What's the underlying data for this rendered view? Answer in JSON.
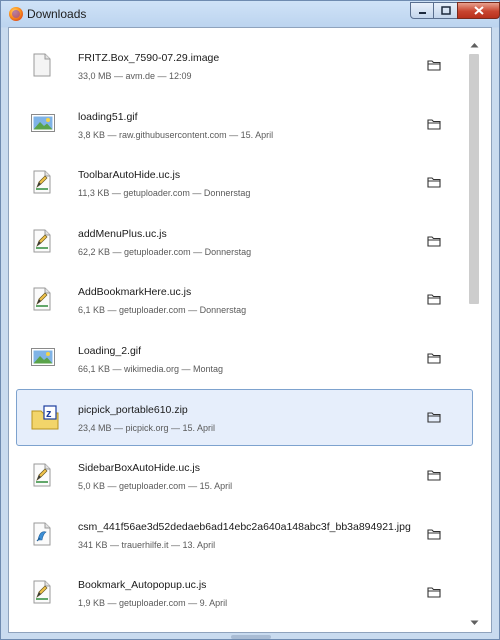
{
  "window": {
    "title": "Downloads"
  },
  "colors": {
    "selection_bg": "#e6eefb",
    "selection_border": "#7da2ce",
    "close_button": "#c8452f"
  },
  "downloads": [
    {
      "name": "FRITZ.Box_7590-07.29.image",
      "meta": "33,0 MB — avm.de — 12:09",
      "icon": "blank-file-icon"
    },
    {
      "name": "loading51.gif",
      "meta": "3,8 KB — raw.githubusercontent.com — 15. April",
      "icon": "image-file-icon"
    },
    {
      "name": "ToolbarAutoHide.uc.js",
      "meta": "11,3 KB — getuploader.com — Donnerstag",
      "icon": "script-file-icon"
    },
    {
      "name": "addMenuPlus.uc.js",
      "meta": "62,2 KB — getuploader.com — Donnerstag",
      "icon": "script-file-icon"
    },
    {
      "name": "AddBookmarkHere.uc.js",
      "meta": "6,1 KB — getuploader.com — Donnerstag",
      "icon": "script-file-icon"
    },
    {
      "name": "Loading_2.gif",
      "meta": "66,1 KB — wikimedia.org — Montag",
      "icon": "image-file-icon"
    },
    {
      "name": "picpick_portable610.zip",
      "meta": "23,4 MB — picpick.org — 15. April",
      "icon": "zip-archive-icon",
      "selected": true
    },
    {
      "name": "SidebarBoxAutoHide.uc.js",
      "meta": "5,0 KB — getuploader.com — 15. April",
      "icon": "script-file-icon"
    },
    {
      "name": "csm_441f56ae3d52dedaeb6ad14ebc2a640a148abc3f_bb3a894921.jpg",
      "meta": "341 KB — trauerhilfe.it — 13. April",
      "icon": "jpg-file-icon"
    },
    {
      "name": "Bookmark_Autopopup.uc.js",
      "meta": "1,9 KB — getuploader.com — 9. April",
      "icon": "script-file-icon"
    }
  ]
}
